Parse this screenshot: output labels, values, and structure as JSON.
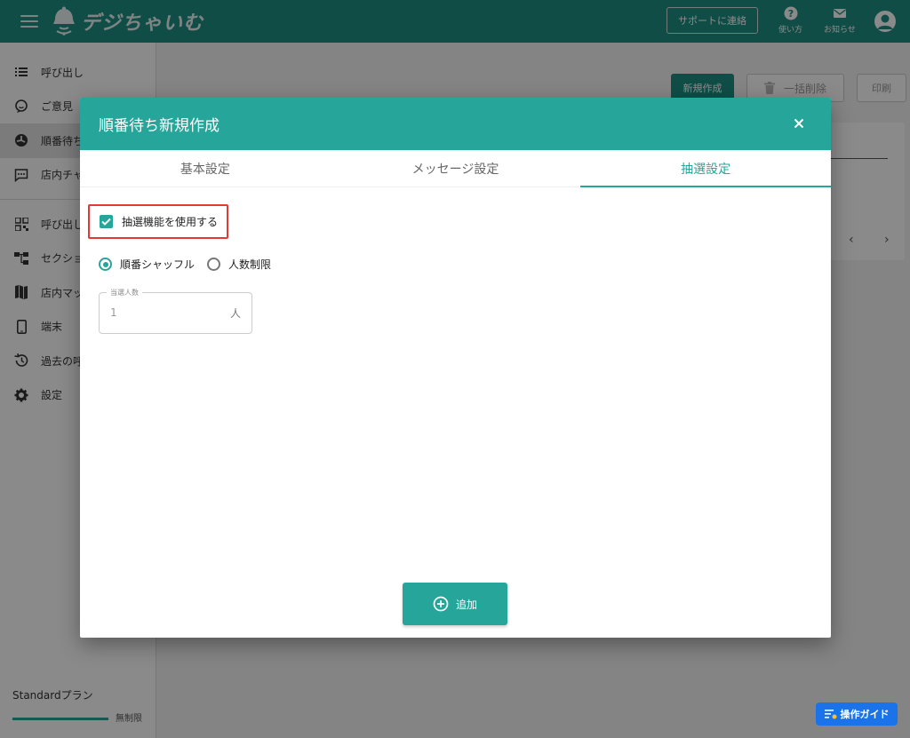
{
  "header": {
    "app_name": "デジちゃいむ",
    "support_label": "サポートに連絡",
    "help_label": "使い方",
    "notice_label": "お知らせ"
  },
  "sidebar": {
    "items": [
      {
        "label": "呼び出し",
        "icon": "list-icon"
      },
      {
        "label": "ご意見",
        "icon": "feedback-icon"
      },
      {
        "label": "順番待ち",
        "icon": "queue-icon",
        "active": true
      },
      {
        "label": "店内チャ",
        "icon": "chat-icon"
      },
      {
        "label": "呼び出し",
        "icon": "qr-icon"
      },
      {
        "label": "セクショ",
        "icon": "section-icon"
      },
      {
        "label": "店内マッ",
        "icon": "map-icon"
      },
      {
        "label": "端末",
        "icon": "device-icon"
      },
      {
        "label": "過去の呼",
        "icon": "history-icon"
      },
      {
        "label": "設定",
        "icon": "gear-icon"
      }
    ],
    "plan_name": "Standardプラン",
    "plan_limit": "無制限"
  },
  "main": {
    "new_label": "新規作成",
    "bulk_delete_label": "一括削除",
    "print_label": "印刷"
  },
  "dialog": {
    "title": "順番待ち新規作成",
    "tabs": [
      {
        "label": "基本設定"
      },
      {
        "label": "メッセージ設定"
      },
      {
        "label": "抽選設定",
        "active": true
      }
    ],
    "lottery_checkbox_label": "抽選機能を使用する",
    "lottery_checked": true,
    "radio_options": [
      {
        "label": "順番シャッフル",
        "selected": true
      },
      {
        "label": "人数制限",
        "selected": false
      }
    ],
    "winners_field": {
      "legend": "当選人数",
      "value": "1",
      "suffix": "人"
    },
    "add_label": "追加"
  },
  "guide_label": "操作ガイド",
  "colors": {
    "header": "#1f8f84",
    "accent": "#26a69a",
    "highlight": "#e53935",
    "guide": "#1a73e8"
  }
}
